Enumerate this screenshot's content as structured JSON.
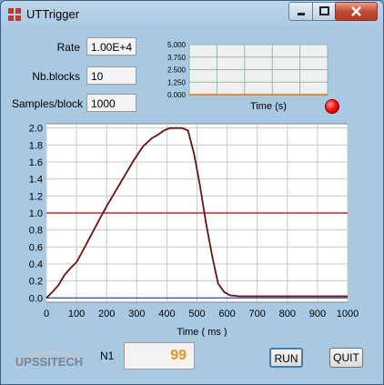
{
  "window": {
    "title": "UTTrigger"
  },
  "params": {
    "rate_label": "Rate",
    "rate_value": "1.00E+4",
    "blocks_label": "Nb.blocks",
    "blocks_value": "10",
    "samples_label": "Samples/block",
    "samples_value": "1000"
  },
  "small_chart": {
    "yticks": [
      "5.000",
      "3.750",
      "2.500",
      "1.250",
      "0.000"
    ],
    "xlabel": "Time (s)"
  },
  "main_chart": {
    "xlabel": "Time ( ms )"
  },
  "counter": {
    "label": "N1",
    "value": "99"
  },
  "buttons": {
    "run": "RUN",
    "quit": "QUIT"
  },
  "logo": {
    "text": "UPSSITECH"
  },
  "colors": {
    "signal": "#6b1010",
    "threshold": "#c00000",
    "baseline": "#1a3fa0",
    "counter": "#f0901c",
    "led": "#ff1010"
  },
  "chart_data": [
    {
      "type": "line",
      "title": "",
      "xlabel": "Time ( ms )",
      "ylabel": "",
      "xlim": [
        0,
        1000
      ],
      "ylim": [
        -0.05,
        2.05
      ],
      "xticks": [
        0,
        100,
        200,
        300,
        400,
        500,
        600,
        700,
        800,
        900,
        1000
      ],
      "yticks": [
        0.0,
        0.2,
        0.4,
        0.6,
        0.8,
        1.0,
        1.2,
        1.4,
        1.6,
        1.8,
        2.0
      ],
      "series": [
        {
          "x": [
            0,
            20,
            40,
            60,
            80,
            100,
            120,
            150,
            180,
            200,
            230,
            260,
            290,
            320,
            350,
            370,
            390,
            410,
            430,
            450,
            470,
            490,
            510,
            530,
            550,
            570,
            590,
            610,
            640,
            700,
            800,
            900,
            1000
          ],
          "y": [
            0.0,
            0.07,
            0.15,
            0.27,
            0.35,
            0.42,
            0.55,
            0.75,
            0.95,
            1.08,
            1.26,
            1.44,
            1.62,
            1.78,
            1.88,
            1.92,
            1.97,
            2.0,
            2.0,
            2.0,
            1.97,
            1.7,
            1.32,
            0.88,
            0.5,
            0.17,
            0.07,
            0.03,
            0.02,
            0.02,
            0.02,
            0.02,
            0.02
          ]
        },
        {
          "x": [
            0,
            1000
          ],
          "y": [
            1.0,
            1.0
          ]
        },
        {
          "x": [
            0,
            1000
          ],
          "y": [
            0.0,
            0.0
          ]
        }
      ]
    },
    {
      "type": "line",
      "title": "",
      "xlabel": "Time (s)",
      "ylabel": "",
      "ylim": [
        0,
        5
      ],
      "yticks": [
        0.0,
        1.25,
        2.5,
        3.75,
        5.0
      ],
      "series": [
        {
          "x": [
            0,
            1
          ],
          "y": [
            0,
            0
          ]
        }
      ]
    }
  ]
}
